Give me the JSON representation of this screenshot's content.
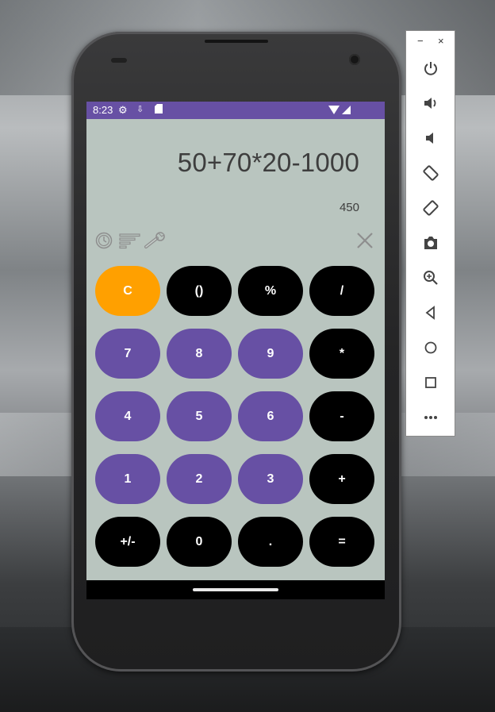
{
  "status_bar": {
    "time": "8:23",
    "icons": [
      "settings-gear-icon",
      "download-icon",
      "sd-card-icon",
      "wifi-icon",
      "signal-icon"
    ]
  },
  "display": {
    "expression": "50+70*20-1000",
    "result": "450"
  },
  "toolbar_icons": [
    "history-icon",
    "unit-converter-icon",
    "scientific-wrench-icon",
    "close-icon"
  ],
  "keypad": {
    "rows": [
      [
        "C",
        "()",
        "%",
        "/"
      ],
      [
        "7",
        "8",
        "9",
        "*"
      ],
      [
        "4",
        "5",
        "6",
        "-"
      ],
      [
        "1",
        "2",
        "3",
        "+"
      ],
      [
        "+/-",
        "0",
        ".",
        "="
      ]
    ]
  },
  "emulator_toolbar": {
    "window_controls": [
      "−",
      "×"
    ],
    "items": [
      "power-icon",
      "volume-up-icon",
      "volume-down-icon",
      "rotate-left-icon",
      "rotate-right-icon",
      "screenshot-camera-icon",
      "zoom-icon",
      "back-icon",
      "home-icon",
      "overview-icon",
      "more-icon"
    ]
  },
  "colors": {
    "status_bar": "#6750a4",
    "screen_bg": "#b9c5bf",
    "digit_button": "#6750a4",
    "operator_button": "#000000",
    "clear_button": "#ffa000"
  }
}
